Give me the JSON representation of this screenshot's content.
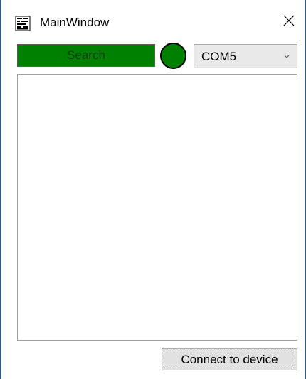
{
  "window": {
    "title": "MainWindow"
  },
  "toolbar": {
    "search_label": "Search",
    "status_color": "#008000",
    "port_selected": "COM5"
  },
  "output": {
    "text": ""
  },
  "footer": {
    "connect_label": "Connect to device"
  },
  "colors": {
    "accent_green": "#008000",
    "window_border": "#1f5fa8"
  },
  "icons": {
    "app": "app-window-icon",
    "close": "close-icon",
    "dropdown": "chevron-down-icon"
  }
}
